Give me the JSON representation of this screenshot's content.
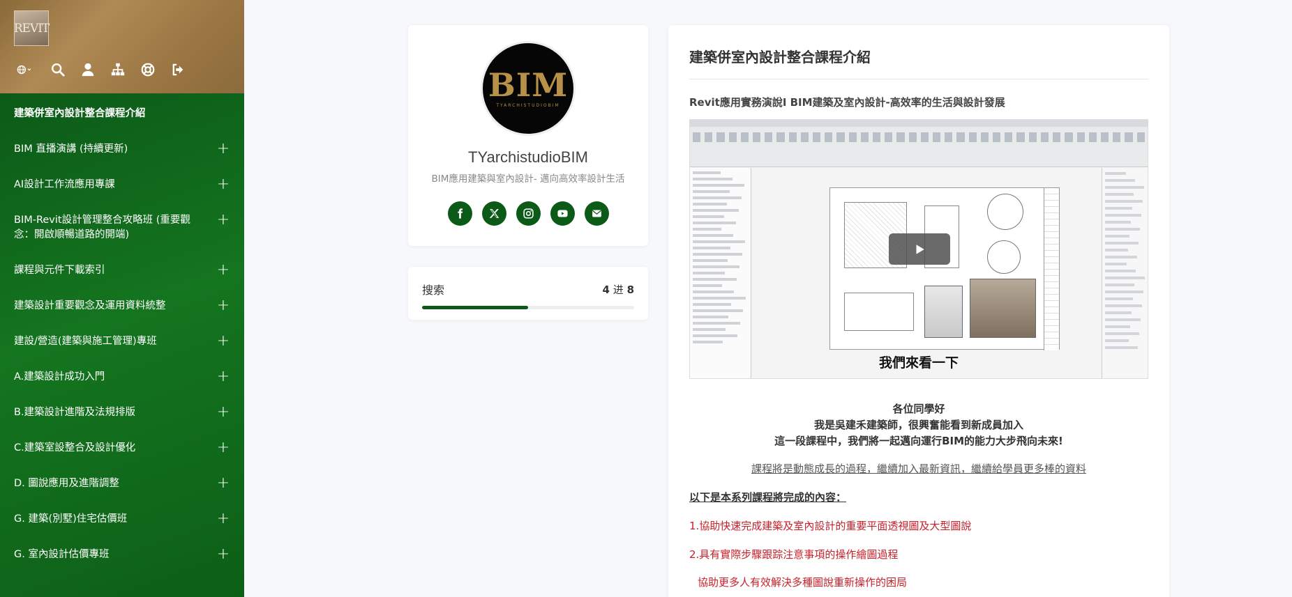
{
  "sidebar": {
    "logo_text": "REVIT",
    "toolbar": [
      {
        "icon": "globe-icon"
      },
      {
        "icon": "search-icon"
      },
      {
        "icon": "user-icon"
      },
      {
        "icon": "sitemap-icon"
      },
      {
        "icon": "support-icon"
      },
      {
        "icon": "logout-icon"
      }
    ],
    "items": [
      {
        "label": "建築併室內設計整合課程介紹",
        "active": true,
        "expandable": false
      },
      {
        "label": "BIM 直播演講 (持續更新)",
        "expandable": true
      },
      {
        "label": "AI設計工作流應用專課",
        "expandable": true
      },
      {
        "label": "BIM-Revit設計管理整合攻略班 (重要觀念：開啟順暢道路的開端)",
        "expandable": true
      },
      {
        "label": "課程與元件下載索引",
        "expandable": true
      },
      {
        "label": "建築設計重要觀念及運用資料統整",
        "expandable": true
      },
      {
        "label": "建設/營造(建築與施工管理)專班",
        "expandable": true
      },
      {
        "label": "A.建築設計成功入門",
        "expandable": true
      },
      {
        "label": "B.建築設計進階及法規排版",
        "expandable": true
      },
      {
        "label": "C.建築室設整合及設計優化",
        "expandable": true
      },
      {
        "label": "D. 圖說應用及進階調整",
        "expandable": true
      },
      {
        "label": "G. 建築(別墅)住宅估價班",
        "expandable": true
      },
      {
        "label": "G. 室內設計估價專班",
        "expandable": true
      }
    ],
    "expand_symbol": "+"
  },
  "profile": {
    "avatar_big": "BIM",
    "avatar_small": "TYARCHISTUDIOBIM",
    "name": "TYarchistudioBIM",
    "tagline": "BIM應用建築與室內設計- 邁向高效率設計生活",
    "socials": [
      {
        "icon": "facebook-icon"
      },
      {
        "icon": "x-twitter-icon"
      },
      {
        "icon": "instagram-icon"
      },
      {
        "icon": "youtube-icon"
      },
      {
        "icon": "email-icon"
      }
    ]
  },
  "progress": {
    "title": "搜索",
    "done": "4",
    "sep": "进",
    "total": "8",
    "fraction": 0.5
  },
  "content": {
    "title": "建築併室內設計整合課程介紹",
    "subtitle": "Revit應用實務演說I BIM建築及室內設計-高效率的生活與設計發展",
    "video_caption": "我們來看一下",
    "intro": [
      "各位同學好",
      "我是吳建禾建築師，很興奮能看到新成員加入",
      "這一段課程中，我們將一起邁向運行BIM的能力大步飛向未來!"
    ],
    "link_line": "課程將是動態成長的過程，繼續加入最新資訊，繼續給學員更多棒的資料",
    "list_head": "以下是本系列課程將完成的內容：",
    "points": [
      "1.協助快速完成建築及室內設計的重要平面透視圖及大型圖說",
      "2.具有實際步驟跟踪注意事項的操作繪圖過程",
      "協助更多人有效解決多種圖說重新操作的困局"
    ]
  },
  "colors": {
    "sidebar_green": "#0c5a18",
    "accent_red": "#c8202a",
    "header_gold": "#9a7642"
  }
}
